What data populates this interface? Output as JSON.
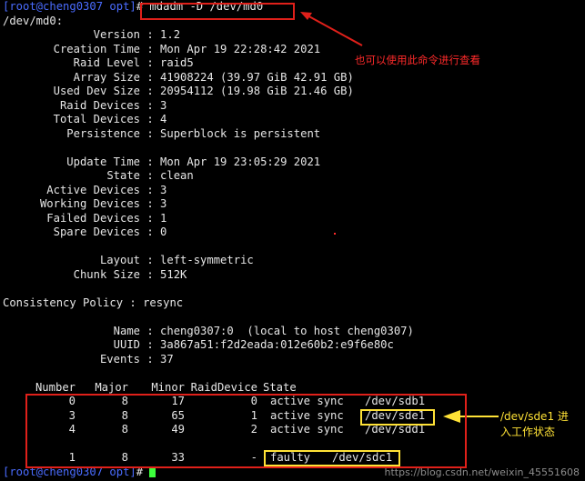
{
  "prompt": {
    "user": "[root@cheng0307 opt]",
    "symbol": "#",
    "command": " mdadm -D /dev/md0"
  },
  "device_header": "/dev/md0:",
  "details1": [
    {
      "key": "Version",
      "value": "1.2"
    },
    {
      "key": "Creation Time",
      "value": "Mon Apr 19 22:28:42 2021"
    },
    {
      "key": "Raid Level",
      "value": "raid5"
    },
    {
      "key": "Array Size",
      "value": "41908224 (39.97 GiB 42.91 GB)"
    },
    {
      "key": "Used Dev Size",
      "value": "20954112 (19.98 GiB 21.46 GB)"
    },
    {
      "key": "Raid Devices",
      "value": "3"
    },
    {
      "key": "Total Devices",
      "value": "4"
    },
    {
      "key": "Persistence",
      "value": "Superblock is persistent"
    }
  ],
  "details2": [
    {
      "key": "Update Time",
      "value": "Mon Apr 19 23:05:29 2021"
    },
    {
      "key": "State",
      "value": "clean"
    },
    {
      "key": "Active Devices",
      "value": "3"
    },
    {
      "key": "Working Devices",
      "value": "3"
    },
    {
      "key": "Failed Devices",
      "value": "1"
    },
    {
      "key": "Spare Devices",
      "value": "0"
    }
  ],
  "details3": [
    {
      "key": "Layout",
      "value": "left-symmetric"
    },
    {
      "key": "Chunk Size",
      "value": "512K"
    }
  ],
  "consistency": {
    "key": "Consistency Policy",
    "value": "resync"
  },
  "details4": [
    {
      "key": "Name",
      "value": "cheng0307:0  (local to host cheng0307)"
    },
    {
      "key": "UUID",
      "value": "3a867a51:f2d2eada:012e60b2:e9f6e80c"
    },
    {
      "key": "Events",
      "value": "37"
    }
  ],
  "table": {
    "headers": [
      "Number",
      "Major",
      "Minor",
      "RaidDevice",
      "State"
    ],
    "rows": [
      {
        "number": "0",
        "major": "8",
        "minor": "17",
        "raid": "0",
        "state": "active sync",
        "dev": "/dev/sdb1"
      },
      {
        "number": "3",
        "major": "8",
        "minor": "65",
        "raid": "1",
        "state": "active sync",
        "dev": "/dev/sde1"
      },
      {
        "number": "4",
        "major": "8",
        "minor": "49",
        "raid": "2",
        "state": "active sync",
        "dev": "/dev/sdd1"
      }
    ],
    "faulty_row": {
      "number": "1",
      "major": "8",
      "minor": "33",
      "raid": "-",
      "state": "faulty",
      "dev": "/dev/sdc1"
    }
  },
  "final_prompt": {
    "user": "[root@cheng0307 opt]",
    "symbol": "#"
  },
  "annotations": {
    "command_note": "也可以使用此命令进行查看",
    "sde1_note_line1": "/dev/sde1 进",
    "sde1_note_line2": "入工作状态"
  },
  "watermark": "https://blog.csdn.net/weixin_45551608",
  "colors": {
    "annotation_red": "#e0201a",
    "annotation_yellow": "#ffe236",
    "prompt_blue": "#4a6cff",
    "cursor_green": "#3cff3c"
  }
}
